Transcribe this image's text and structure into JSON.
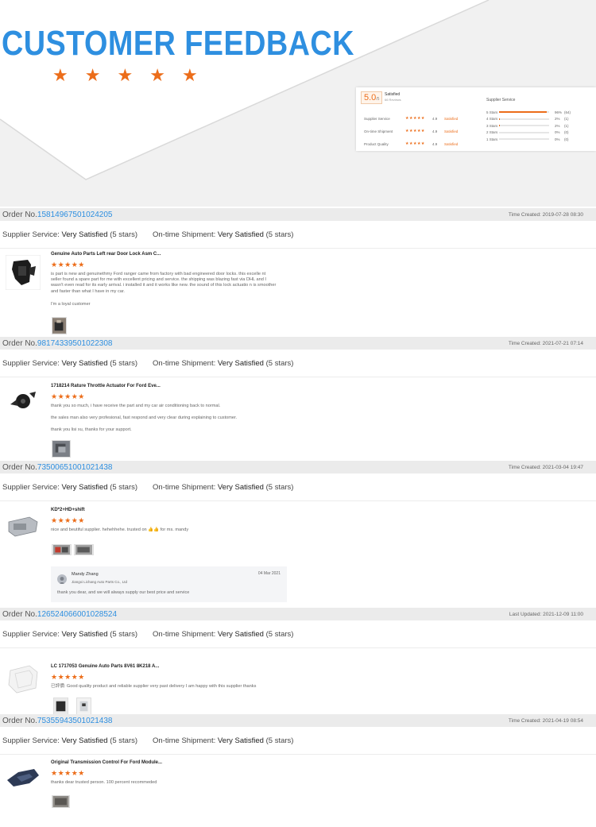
{
  "hero": {
    "title": "CUSTOMER FEEDBACK",
    "stars": "★"
  },
  "summary": {
    "score": "5.0",
    "score_suffix": "/5",
    "satisfied": "Satisfied",
    "reviews": "66 Reviews",
    "rows": [
      {
        "name": "Supplier Service",
        "score": "4.9",
        "label": "Satisfied"
      },
      {
        "name": "On-time Shipment",
        "score": "4.9",
        "label": "Satisfied"
      },
      {
        "name": "Product Quality",
        "score": "4.9",
        "label": "Satisfied"
      }
    ],
    "stars5": "★★★★★",
    "breakdown_title": "Supplier Service",
    "breakdown": [
      {
        "label": "5 Stars",
        "pct": "96%",
        "count": "(64)",
        "fraction": 0.96
      },
      {
        "label": "4 Stars",
        "pct": "2%",
        "count": "(1)",
        "fraction": 0.02
      },
      {
        "label": "3 Stars",
        "pct": "2%",
        "count": "(1)",
        "fraction": 0.02
      },
      {
        "label": "2 Stars",
        "pct": "0%",
        "count": "(0)",
        "fraction": 0
      },
      {
        "label": "1 Stars",
        "pct": "0%",
        "count": "(0)",
        "fraction": 0
      }
    ]
  },
  "labels": {
    "order_no": "Order No.",
    "supplier_service": "Supplier Service:",
    "ontime_shipment": "On-time Shipment:",
    "very_satisfied": "Very Satisfied",
    "five_stars": "(5 stars)",
    "rating_stars": "★★★★★"
  },
  "orders": [
    {
      "number": "15814967501024205",
      "time": "Time Created: 2019-07-28 08:30",
      "product": "Genuine Auto Parts Left rear Door Lock Asm C...",
      "text1": "is part is new and genuinethmy Ford ranger came from factory with bad engineered door locks. this excelle nt seller found a spare part for me with excellent pricing and service. the shipping was blazing fast via DHL and I wasn't even read for its early arrival. i installed it and it works like new. the sound of this lock actuatio n is smoother and faster than what I have in my car.",
      "text2": "I'm a loyal customer"
    },
    {
      "number": "98174339501022308",
      "time": "Time Created: 2021-07-21 07:14",
      "product": "1718214 Rature Throttle Actuator For Ford Eve...",
      "text1": "thank you so much, i have receive the part and my car air conditioning back to normal.",
      "text2": "the sales man also very profesional, fast respond and very clear during explaining to customer.",
      "text3": "thank you lisi xu, thanks for your support."
    },
    {
      "number": "73500651001021438",
      "time": "Time Created: 2021-03-04 19:47",
      "product": "KD*2+HD+shift",
      "text1": "nice and beutiful supplier. hehehhehe. trusted on 👍👍 for ms. mandy",
      "reply": {
        "name": "Mandy Zhang",
        "company": "Jiangxi Lichang Auto Parts Co., Ltd",
        "date": "04 Mar 2021",
        "text": "thank you dear, and we will always supply our best price and service"
      }
    },
    {
      "number": "126524066001028524",
      "time": "Last Updated: 2021-12-09 11:00",
      "product": "LC 1717053 Genuine Auto Parts 8V61 8K218 A...",
      "text1": "已評價: Good quality product and reliable supplier very past delivery I am happy with this supplier thanks"
    },
    {
      "number": "75355943501021438",
      "time": "Time Created: 2021-04-19 08:54",
      "product": "Original Transmission Control For Ford Module...",
      "text1": "thanks dear trusted person. 100 percent recommeded"
    }
  ]
}
